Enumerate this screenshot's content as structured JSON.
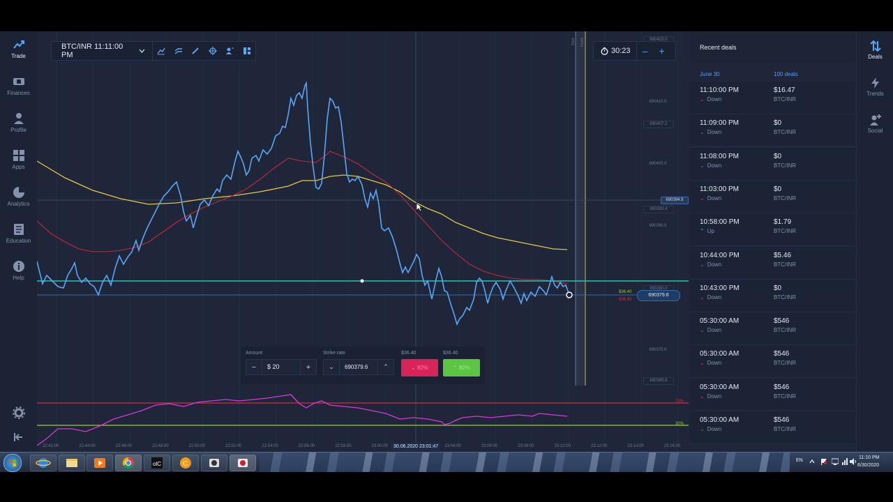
{
  "nav": {
    "items": [
      {
        "label": "Trade",
        "icon": "trade-chart-icon",
        "active": true
      },
      {
        "label": "Finances",
        "icon": "wallet-icon"
      },
      {
        "label": "Profile",
        "icon": "user-icon"
      },
      {
        "label": "Apps",
        "icon": "apps-grid-icon"
      },
      {
        "label": "Analytics",
        "icon": "pie-chart-icon"
      },
      {
        "label": "Education",
        "icon": "book-icon"
      },
      {
        "label": "Help",
        "icon": "info-icon"
      }
    ]
  },
  "toolbar": {
    "asset": "BTC/INR 11:11:00 PM",
    "tools": [
      "indicator-icon",
      "line-tool-icon",
      "draw-icon",
      "crosshair-icon",
      "social-icon",
      "layout-icon"
    ]
  },
  "timer": {
    "value": "30:23",
    "minus": "–",
    "plus": "+"
  },
  "chart": {
    "price_labels": [
      "690423.0",
      "690410.0",
      "690407.2",
      "690400.0",
      "690394.9",
      "690393.4",
      "690390.0",
      "690380.0",
      "690379.6",
      "690370.0",
      "690365.8"
    ],
    "payout_up": "$36.40",
    "payout_down": "$36.40",
    "start_label": "Start",
    "finish_label": "Finish",
    "time_ticks": [
      "22:42:00",
      "22:44:00",
      "22:46:00",
      "22:48:00",
      "22:50:00",
      "22:52:00",
      "22:54:00",
      "22:56:00",
      "22:58:00",
      "23:00:00",
      "23:02:00",
      "23:04:00",
      "23:06:00",
      "23:08:00",
      "23:10:00",
      "23:12:00",
      "23:14:00",
      "23:16:00"
    ],
    "crosshair_time": "30.06.2020 23:01:47",
    "osc_levels": [
      "70%",
      "30%"
    ],
    "colors": {
      "price": "#5aa7f5",
      "ema_fast": "#c22a3a",
      "ema_slow": "#e3c842",
      "strike": "#26c6b0",
      "osc": "#d63ad6",
      "osc_high": "#d82c3f",
      "osc_low": "#9ccc2f"
    }
  },
  "trade": {
    "amount_label": "Amount",
    "amount_value": "$ 20",
    "strike_label": "Strike rate",
    "strike_value": "690379.6",
    "down_payout": "$36.40",
    "up_payout": "$36.40",
    "down_pct": "82%",
    "up_pct": "82%"
  },
  "deals": {
    "title": "Recent deals",
    "date": "June 30",
    "count": "100 deals",
    "items": [
      {
        "time": "11:10:00 PM",
        "dir": "Down",
        "amount": "$16.47",
        "pair": "BTC/INR"
      },
      {
        "time": "11:09:00 PM",
        "dir": "Down",
        "amount": "$0",
        "pair": "BTC/INR"
      },
      {
        "time": "11:08:00 PM",
        "dir": "Down",
        "amount": "$0",
        "pair": "BTC/INR"
      },
      {
        "time": "11:03:00 PM",
        "dir": "Down",
        "amount": "$0",
        "pair": "BTC/INR"
      },
      {
        "time": "10:58:00 PM",
        "dir": "Up",
        "amount": "$1.79",
        "pair": "BTC/INR"
      },
      {
        "time": "10:44:00 PM",
        "dir": "Down",
        "amount": "$5.46",
        "pair": "BTC/INR"
      },
      {
        "time": "10:43:00 PM",
        "dir": "Down",
        "amount": "$0",
        "pair": "BTC/INR"
      },
      {
        "time": "05:30:00 AM",
        "dir": "Down",
        "amount": "$546",
        "pair": "BTC/INR"
      },
      {
        "time": "05:30:00 AM",
        "dir": "Down",
        "amount": "$546",
        "pair": "BTC/INR"
      },
      {
        "time": "05:30:00 AM",
        "dir": "Down",
        "amount": "$546",
        "pair": "BTC/INR"
      },
      {
        "time": "05:30:00 AM",
        "dir": "Down",
        "amount": "$546",
        "pair": "BTC/INR"
      }
    ]
  },
  "rail": {
    "items": [
      {
        "label": "Deals",
        "icon": "deals-arrows-icon",
        "active": true
      },
      {
        "label": "Trends",
        "icon": "lightning-icon"
      },
      {
        "label": "Social",
        "icon": "add-user-icon"
      }
    ]
  },
  "taskbar": {
    "lang": "EN",
    "time": "11:10 PM",
    "date": "6/30/2020"
  }
}
